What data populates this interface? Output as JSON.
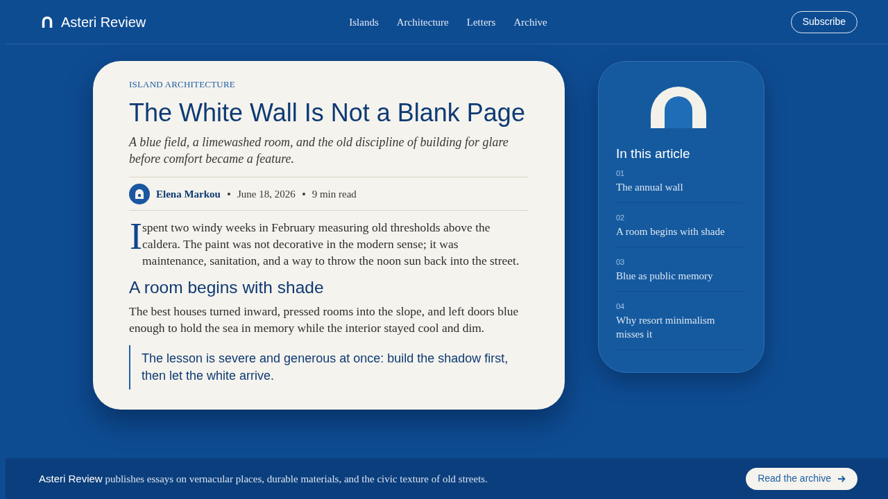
{
  "header": {
    "brand": "Asteri Review",
    "nav": [
      {
        "label": "Islands"
      },
      {
        "label": "Architecture"
      },
      {
        "label": "Letters"
      },
      {
        "label": "Archive"
      }
    ],
    "subscribe": "Subscribe"
  },
  "article": {
    "kicker": "ISLAND ARCHITECTURE",
    "title": "The White Wall Is Not a Blank Page",
    "dek": "A blue field, a limewashed room, and the old discipline of building for glare before comfort became a feature.",
    "byline": {
      "author": "Elena Markou",
      "date": "June 18, 2026",
      "read_time": "9 min read"
    },
    "lead": {
      "drop_cap": "I",
      "text": "spent two windy weeks in February measuring old thresholds above the caldera. The paint was not decorative in the modern sense; it was maintenance, sanitation, and a way to throw the noon sun back into the street."
    },
    "subheading": "A room begins with shade",
    "paragraph": "The best houses turned inward, pressed rooms into the slope, and left doors blue enough to hold the sea in memory while the interior stayed cool and dim.",
    "pullquote": "The lesson is severe and generous at once: build the shadow first, then let the white arrive."
  },
  "toc": {
    "title": "In this article",
    "items": [
      {
        "number": "01",
        "label": "The annual wall"
      },
      {
        "number": "02",
        "label": "A room begins with shade"
      },
      {
        "number": "03",
        "label": "Blue as public memory"
      },
      {
        "number": "04",
        "label": "Why resort minimalism misses it"
      }
    ]
  },
  "footer": {
    "text": "**Asteri Review** publishes essays on vernacular places, durable materials, and the civic texture of old streets.",
    "button": "Read the archive"
  }
}
